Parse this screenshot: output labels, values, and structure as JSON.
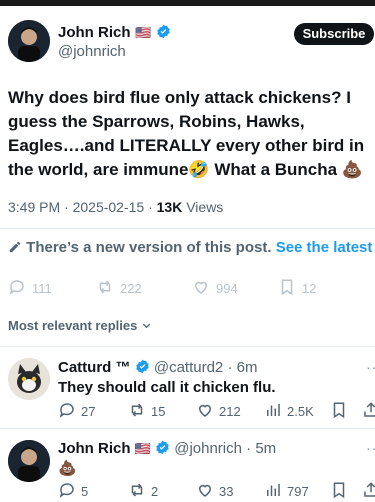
{
  "post": {
    "author_name": "John Rich",
    "flag": "🇺🇸",
    "handle": "@johnrich",
    "subscribe_label": "Subscribe",
    "text": "Why does bird flue only attack chickens? I guess the Sparrows, Robins, Hawks, Eagles….and LITERALLY every other bird in the world, are immune🤣 What a Buncha 💩",
    "time": "3:49 PM · 2025-02-15 · ",
    "views_count": "13K",
    "views_label": " Views",
    "new_version_text": "There’s a new version of this post.",
    "new_version_link": "See the latest",
    "stats": {
      "replies": "111",
      "reposts": "222",
      "likes": "994",
      "bookmarks": "12"
    }
  },
  "replies_sort_label": "Most relevant replies",
  "replies": [
    {
      "name": "Catturd ™",
      "handle": "@catturd2",
      "age": " · 6m",
      "text": "They should call it chicken flu.",
      "replies": "27",
      "reposts": "15",
      "likes": "212",
      "views": "2.5K"
    },
    {
      "name": "John Rich",
      "flag": "🇺🇸",
      "handle": "@johnrich",
      "age": " · 5m",
      "text": "💩",
      "replies": "5",
      "reposts": "2",
      "likes": "33",
      "views": "797"
    }
  ],
  "colors": {
    "accent": "#1d9bf0",
    "text": "#0f1419",
    "muted": "#536471",
    "faded": "#b9c3cc"
  }
}
